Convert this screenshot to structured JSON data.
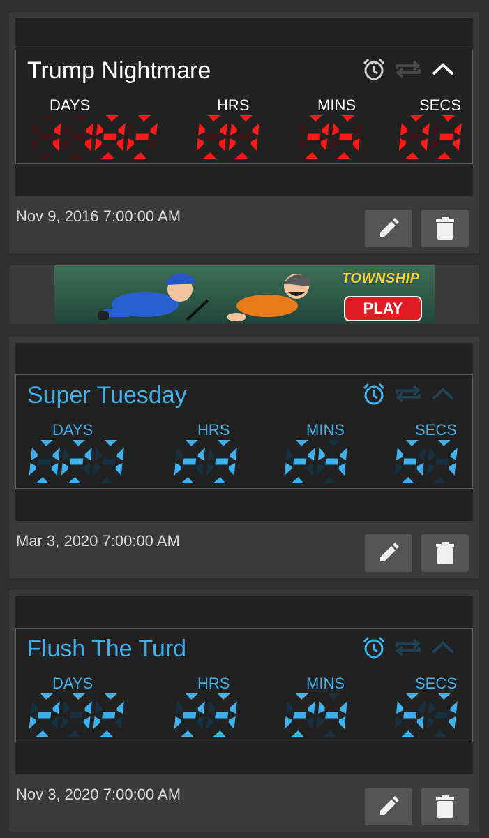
{
  "timers": [
    {
      "title": "Trump Nightmare",
      "labels": {
        "days": "DAYS",
        "hrs": "HRS",
        "mins": "MINS",
        "secs": "SECS"
      },
      "days": "1182",
      "hrs": "00",
      "mins": "35",
      "secs": "03",
      "days_mask": "8888",
      "date": "Nov 9, 2016 7:00:00 AM",
      "theme": "red",
      "digit_color": "#ff1a1a",
      "ghost_color": "#3a1515",
      "title_color": "#ffffff",
      "label_color": "#ffffff"
    },
    {
      "title": "Super Tuesday",
      "labels": {
        "days": "DAYS",
        "hrs": "HRS",
        "mins": "MINS",
        "secs": "SECS"
      },
      "days": "027",
      "hrs": "23",
      "mins": "24",
      "secs": "57",
      "days_mask": "888",
      "date": "Mar 3, 2020 7:00:00 AM",
      "theme": "blue",
      "digit_color": "#3fb0ee",
      "ghost_color": "#173040",
      "title_color": "#3fb0ee",
      "label_color": "#3fb0ee"
    },
    {
      "title": "Flush The Turd",
      "labels": {
        "days": "DAYS",
        "hrs": "HRS",
        "mins": "MINS",
        "secs": "SECS"
      },
      "days": "272",
      "hrs": "23",
      "mins": "24",
      "secs": "57",
      "days_mask": "888",
      "date": "Nov 3, 2020 7:00:00 AM",
      "theme": "blue",
      "digit_color": "#3fb0ee",
      "ghost_color": "#173040",
      "title_color": "#3fb0ee",
      "label_color": "#3fb0ee"
    }
  ],
  "ad": {
    "brand": "TOWNSHIP",
    "cta": "PLAY"
  },
  "icons": {
    "alarm": "alarm-clock-icon",
    "repeat": "repeat-icon",
    "collapse": "chevron-up-icon",
    "edit": "pencil-icon",
    "delete": "trash-icon"
  }
}
